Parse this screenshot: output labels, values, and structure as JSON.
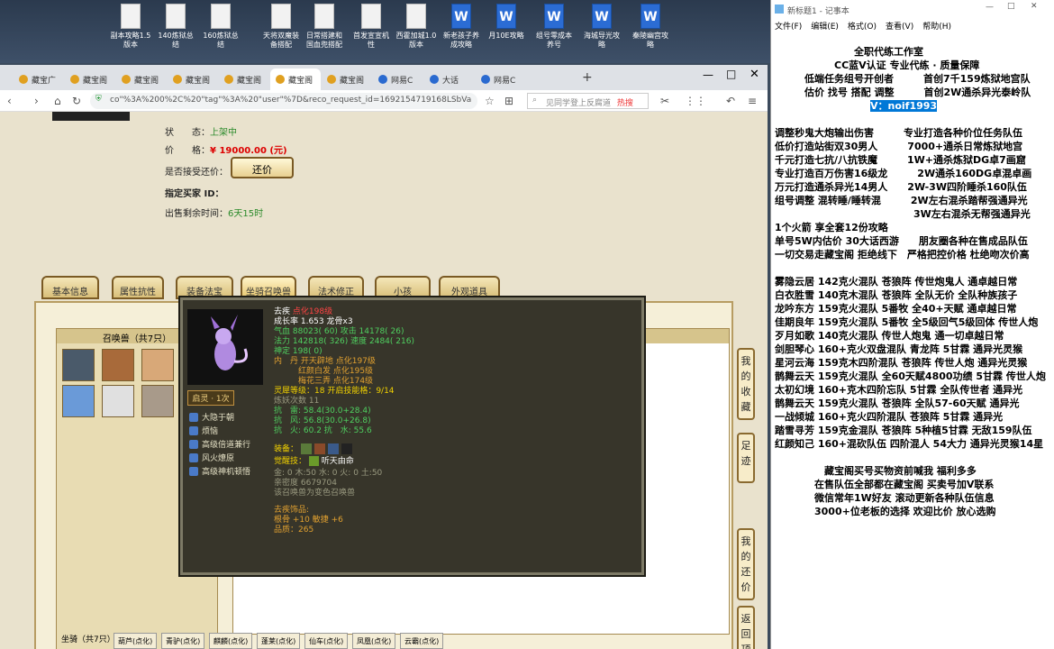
{
  "desktop_icons": [
    {
      "label": "副本攻略1.5版本",
      "type": "doc"
    },
    {
      "label": "140炼狱总结",
      "type": "doc"
    },
    {
      "label": "160炼狱总结",
      "type": "doc"
    },
    {
      "label": "天将双魔装备搭配",
      "type": "doc"
    },
    {
      "label": "日常搭建和国血兜搭配",
      "type": "doc"
    },
    {
      "label": "首发宣宣机性",
      "type": "doc"
    },
    {
      "label": "西霍加城1.0版本",
      "type": "doc"
    },
    {
      "label": "新老孩子养成攻略",
      "type": "word"
    },
    {
      "label": "月10E攻略",
      "type": "word"
    },
    {
      "label": "组号零成本养号",
      "type": "word"
    },
    {
      "label": "海城导光攻略",
      "type": "word"
    },
    {
      "label": "秦陵幽宫攻略",
      "type": "word"
    }
  ],
  "browser": {
    "tabs": [
      "藏宝广",
      "藏宝阁",
      "藏宝阁",
      "藏宝阁",
      "藏宝阁",
      "藏宝阁",
      "藏宝阁",
      "网易C",
      "大话",
      "网易C"
    ],
    "url": "co\"%3A%200%2C%20\"tag\"%3A%20\"user\"%7D&reco_request_id=1692154719168LSbVa",
    "search_placeholder": "见同学登上反腐道",
    "search_tag": "热搜"
  },
  "listing": {
    "status_label": "状　　态：",
    "status_value": "上架中",
    "price_label": "价　　格：",
    "price_value": "¥ 19000.00 (元)",
    "bargain_label": "是否接受还价：",
    "bargain_button": "还价",
    "buyer_label": "指定买家 ID：",
    "buyer_value": "",
    "time_label": "出售剩余时间：",
    "time_value": "6天15时"
  },
  "game_tabs": [
    "基本信息",
    "属性抗性",
    "装备法宝",
    "坐骑召唤兽",
    "法术修正",
    "小孩",
    "外观道具"
  ],
  "summon_title": "召唤兽（共7只）",
  "detail_title": "去疾",
  "tooltip": {
    "badge": "启灵 · 1次",
    "skills": [
      "大隐于朝",
      "烦恼",
      "高级倍道兼行",
      "风火燎原",
      "高级神机顿悟"
    ],
    "name": "去疾",
    "tag": "点化198级",
    "growth": "成长率 1.653 龙骨x3",
    "line_hp": "气血 88023( 60) 攻击 14178( 26)",
    "line_mp": "法力 142818( 326) 速度 2484( 216)",
    "line_fate": "神定 198( 0)",
    "line_d1": "内　丹 开天辟地 点化197级",
    "line_d2": "　　　红颜白发 点化195级",
    "line_d3": "　　　梅花三弄 点化174级",
    "line_soul": "灵犀等级：18 开启技能格：9/14",
    "line_demon": "炼妖次数 11",
    "line_r1": "抗　雷: 58.4(30.0+28.4)",
    "line_r2": "抗　风: 56.8(30.0+26.8)",
    "line_r3": "抗　火: 60.2 抗　水: 55.6",
    "equip_label": "装备：",
    "awaken_label": "觉醒技：",
    "awaken_value": "听天由命",
    "line_e1": "金: 0 木:50 水: 0 火: 0 土:50",
    "line_e2": "亲密度 6679704",
    "line_e3": "该召唤兽为变色召唤兽",
    "orn_title": "去疾饰品:",
    "orn_1": "根骨 +10 敏捷 +6",
    "orn_2": "品质：265"
  },
  "side_buttons": [
    "我的收藏",
    "足迹",
    "我的还价",
    "返回顶部"
  ],
  "mount_label": "坐骑（共7只）",
  "bottom_tabs": [
    "葫芦(点化)",
    "青驴(点化)",
    "麒麟(点化)",
    "蓬莱(点化)",
    "仙车(点化)",
    "凤凰(点化)",
    "云霸(点化)"
  ],
  "notepad": {
    "title": "新标题1 - 记事本",
    "menu": [
      "文件(F)",
      "编辑(E)",
      "格式(O)",
      "查看(V)",
      "帮助(H)"
    ],
    "wechat": "V：noif1993",
    "top": "　　　　　　　　全职代练工作室\n　　　　　　CC蓝V认证 专业代练 · 质量保障\n　　　低端任务组号开创者　　　首创7千159炼狱地宫队\n　　　估价 找号 搭配 调整　　　首创2W通杀异光泰岭队",
    "body": "调整秒鬼大炮输出伤害　　　专业打造各种价位任务队伍\n低价打造站街双30男人　　　7000+通杀日常炼狱地宫\n千元打造七抗/八抗铁魔　　　1W+通杀炼狱DG卓7画窟\n专业打造百万伤害16级龙　　　2W通杀160DG卓混卓画\n万元打造通杀异光14男人　　2W-3W四阶睡杀160队伍\n组号调整 混转睡/睡转混　　　2W左右混杀踏帮强通异光\n　　　　　　　　　　　　　　3W左右混杀无帮强通异光\n1个火箭 享全套12份攻略\n单号5W内估价 30大话西游　　朋友圈各种在售成品队伍\n一切交易走藏宝阁 拒绝线下　严格把控价格 杜绝吻次价高\n\n雾隐云居 142克火混队 苍狼阵 传世炮鬼人 通卓越日常\n白衣胜雪 140克木混队 苍狼阵 全队无价 全队种族孩子\n龙吟东方 159克火混队 5番牧 全40+天赋 通卓越日常\n佳期良年 159克火混队 5番牧 全5级回气5级回体 传世人炮\n歹月如歌 140克火混队 传世人炮鬼 通一切卓越日常\n剑胆琴心 160+克火双盘混队 青龙阵 5甘霖 通异光灵猴\n星河云海 159克木四阶混队 苍狼阵 传世人炮 通异光灵猴\n鹊舞云天 159克火混队 全60天赋4800功绩 5甘霖 传世人炮\n太初幻境 160+克木四阶忘队 5甘霖 全队传世者 通异光\n鹊舞云天 159克火混队 苍狼阵 全队57-60天赋 通异光\n一战倾城 160+克火四阶混队 苍狼阵 5甘霖 通异光\n踏雪寻芳 159克金混队 苍狼阵 5种植5甘霖 无敌159队伍\n红颜知己 160+混砍队伍 四阶混人 54大力 通异光灵猴14星\n\n　　　　　藏宝阁买号买物资前喊我 福利多多\n　　　　在售队伍全部都在藏宝阁 买卖号加V联系\n　　　　微信常年1W好友 滚动更新各种队伍信息\n　　　　3000+位老板的选择 欢迎比价 放心选购"
  }
}
